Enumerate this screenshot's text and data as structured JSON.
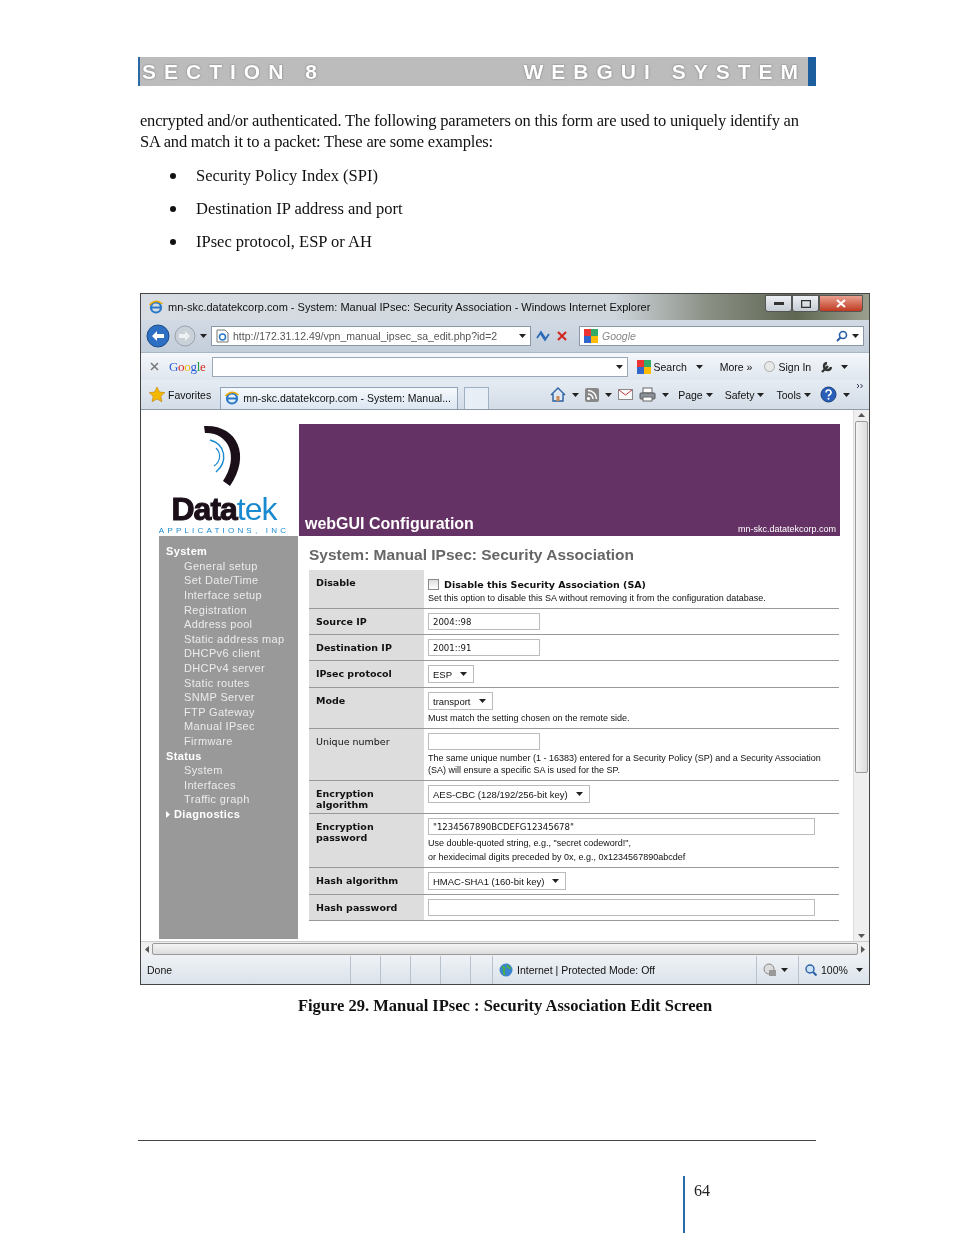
{
  "document": {
    "header_left": "SECTION 8",
    "header_right": "WEBGUI SYSTEM",
    "paragraph": "encrypted and/or authenticated.  The following parameters on this form are used to uniquely identify an SA and match it to a packet: These are some examples:",
    "bullets": [
      "Security Policy Index (SPI)",
      "Destination IP address and port",
      "IPsec protocol, ESP or AH"
    ],
    "caption": "Figure 29. Manual IPsec : Security Association Edit Screen",
    "page_number": "64"
  },
  "browser": {
    "title": "mn-skc.datatekcorp.com - System: Manual IPsec: Security Association - Windows Internet Explorer",
    "address": "http://172.31.12.49/vpn_manual_ipsec_sa_edit.php?id=2",
    "search_placeholder": "Google",
    "google_logo": "Google",
    "toolbar_search": "Search",
    "toolbar_more": "More »",
    "toolbar_sign_in": "Sign In",
    "favorites": "Favorites",
    "tab": "mn-skc.datatekcorp.com - System: Manual...",
    "commands": [
      "Page",
      "Safety",
      "Tools"
    ],
    "status": "Done",
    "zone": "Internet | Protected Mode: Off",
    "zoom": "100%"
  },
  "page": {
    "logo_strong": "Data",
    "logo_light": "tek",
    "logo_tagline": "APPLICATIONS, INC",
    "banner_title": "webGUI Configuration",
    "host": "mn-skc.datatekcorp.com",
    "nav": [
      {
        "label": "System",
        "expanded": true,
        "children": [
          "General setup",
          "Set Date/Time",
          "Interface setup",
          "Registration",
          "Address pool",
          "Static address map",
          "DHCPv6 client",
          "DHCPv4 server",
          "Static routes",
          "SNMP Server",
          "FTP Gateway",
          "Manual IPsec",
          "Firmware"
        ]
      },
      {
        "label": "Status",
        "expanded": true,
        "children": [
          "System",
          "Interfaces",
          "Traffic graph"
        ]
      },
      {
        "label": "Diagnostics",
        "expanded": false
      }
    ],
    "heading": "System: Manual IPsec: Security Association",
    "rows": [
      {
        "label": "Disable",
        "bold": true,
        "kind": "checkbox",
        "checked": false,
        "option": "Disable this Security Association (SA)",
        "hints": [
          "Set this option to disable this SA without removing it from the configuration database."
        ]
      },
      {
        "label": "Source IP",
        "bold": true,
        "kind": "text",
        "value": "2004::98"
      },
      {
        "label": "Destination IP",
        "bold": true,
        "kind": "text",
        "value": "2001::91"
      },
      {
        "label": "IPsec protocol",
        "bold": true,
        "kind": "select",
        "value": "ESP"
      },
      {
        "label": "Mode",
        "bold": true,
        "kind": "select",
        "value": "transport",
        "hints": [
          "Must match the setting chosen on the remote side."
        ]
      },
      {
        "label": "Unique number",
        "bold": false,
        "kind": "text",
        "hints": [
          "The same unique number (1 - 16383) entered for a Security Policy (SP) and a Security Association (SA) will ensure a specific SA is used for the SP."
        ]
      },
      {
        "label": "Encryption algorithm",
        "bold": true,
        "kind": "select",
        "value": "AES-CBC (128/192/256-bit key)"
      },
      {
        "label": "Encryption password",
        "bold": true,
        "kind": "longtext",
        "value": "\"1234567890BCDEFG12345678\"",
        "hints": [
          "Use double-quoted string, e.g., \"secret codeword!\",",
          "or hexidecimal digits preceded by 0x, e.g., 0x1234567890abcdef"
        ]
      },
      {
        "label": "Hash algorithm",
        "bold": true,
        "kind": "select",
        "value": "HMAC-SHA1 (160-bit key)"
      },
      {
        "label": "Hash password",
        "bold": true,
        "kind": "longtext"
      }
    ]
  }
}
